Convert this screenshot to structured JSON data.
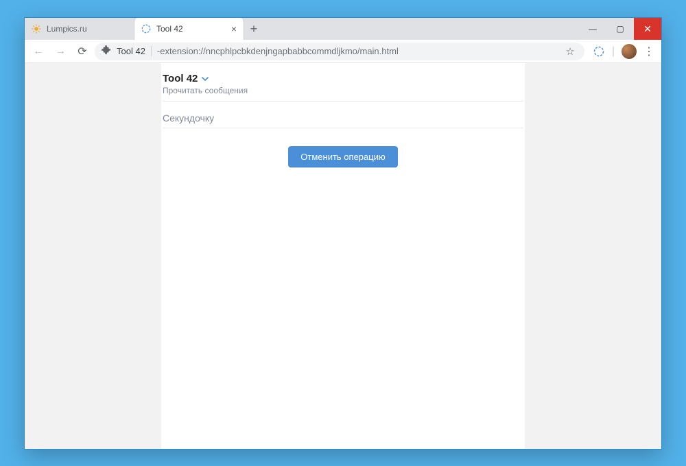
{
  "colors": {
    "accent": "#4a8fd8",
    "window_bg": "#52b1e9",
    "close_btn": "#d9342b"
  },
  "tabs": [
    {
      "title": "Lumpics.ru",
      "favicon": "sun-icon",
      "active": false
    },
    {
      "title": "Tool 42",
      "favicon": "tool42-icon",
      "active": true
    }
  ],
  "window_controls": {
    "minimize": "—",
    "maximize": "▢",
    "close": "✕"
  },
  "newtab_label": "+",
  "toolbar": {
    "back": "←",
    "forward": "→",
    "reload": "⟳",
    "extension_label": "Tool 42",
    "url": "-extension://nncphlpcbkdenjngapbabbcommdljkmo/main.html",
    "star": "☆",
    "menu": "⋮"
  },
  "page": {
    "title": "Tool 42",
    "subtitle": "Прочитать сообщения",
    "status": "Секундочку",
    "cancel_button": "Отменить операцию"
  }
}
